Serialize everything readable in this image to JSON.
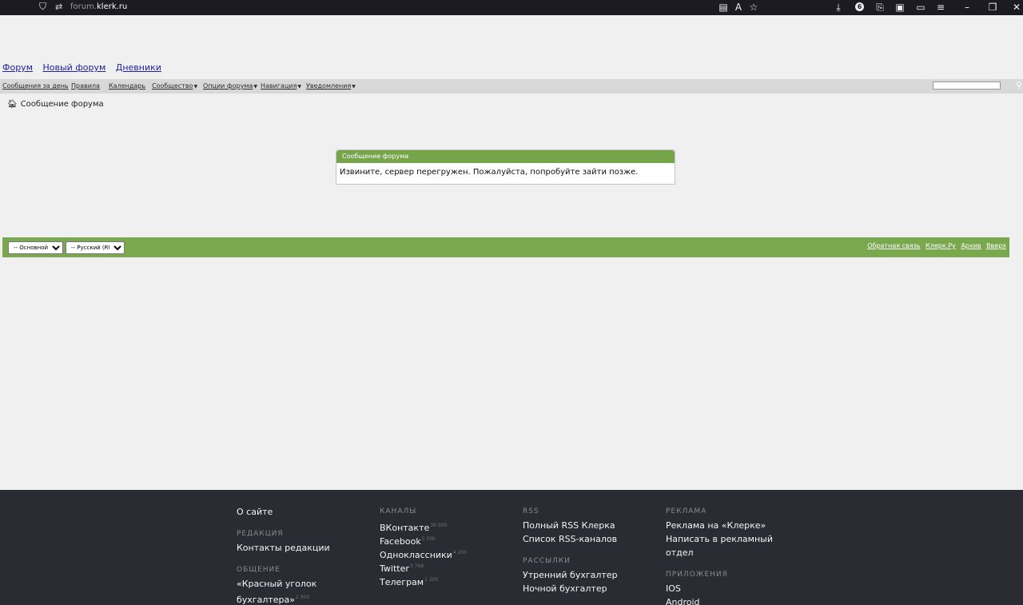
{
  "browser": {
    "url_host_prefix": "forum.",
    "url_host_domain": "klerk.ru"
  },
  "toplinks": [
    "Форум",
    "Новый форум",
    "Дневники"
  ],
  "nav": {
    "items": [
      {
        "label": "Сообщения за день",
        "dropdown": false
      },
      {
        "label": "Правила",
        "dropdown": false
      },
      {
        "label": "Календарь",
        "dropdown": false
      },
      {
        "label": "Сообщество",
        "dropdown": true
      },
      {
        "label": "Опции форума",
        "dropdown": true
      },
      {
        "label": "Навигация",
        "dropdown": true
      },
      {
        "label": "Уведомления",
        "dropdown": true
      }
    ]
  },
  "breadcrumb": {
    "label": "Сообщение форума"
  },
  "message": {
    "title": "Сообщение форума",
    "text": "Извините, сервер перегружен. Пожалуйста, попробуйте зайти позже."
  },
  "footerbar": {
    "style_select": "-- Основной",
    "lang_select": "-- Русский (RU)",
    "links": [
      "Обратная связь",
      "Клерк.Ру",
      "Архив",
      "Вверх"
    ]
  },
  "sitefooter": {
    "col1": {
      "about": "О сайте",
      "h_redaction": "РЕДАКЦИЯ",
      "contacts": "Контакты редакции",
      "h_talk": "ОБЩЕНИЕ",
      "corner_line1": "«Красный уголок",
      "corner_line2": "бухгалтера»",
      "corner_count": "2 900"
    },
    "col2": {
      "h_channels": "КАНАЛЫ",
      "channels": [
        {
          "name": "ВКонтакте",
          "count": "36 000"
        },
        {
          "name": "Facebook",
          "count": "5 500"
        },
        {
          "name": "Одноклассники",
          "count": "4 200"
        },
        {
          "name": "Twitter",
          "count": "3 768"
        },
        {
          "name": "Телеграм",
          "count": "1 200"
        }
      ]
    },
    "col3": {
      "h_rss": "RSS",
      "rss": [
        "Полный RSS Клерка",
        "Список RSS-каналов"
      ],
      "h_mail": "РАССЫЛКИ",
      "mail": [
        "Утренний бухгалтер",
        "Ночной бухгалтер"
      ]
    },
    "col4": {
      "h_ads": "РЕКЛАМА",
      "ads1": "Реклама на «Клерке»",
      "ads2_line1": "Написать в рекламный",
      "ads2_line2": "отдел",
      "h_apps": "ПРИЛОЖЕНИЯ",
      "apps": [
        "IOS",
        "Android"
      ]
    }
  },
  "colors": {
    "accent_green": "#7aa84e",
    "footer_dark": "#2b2b33",
    "link_blue": "#22229c"
  }
}
